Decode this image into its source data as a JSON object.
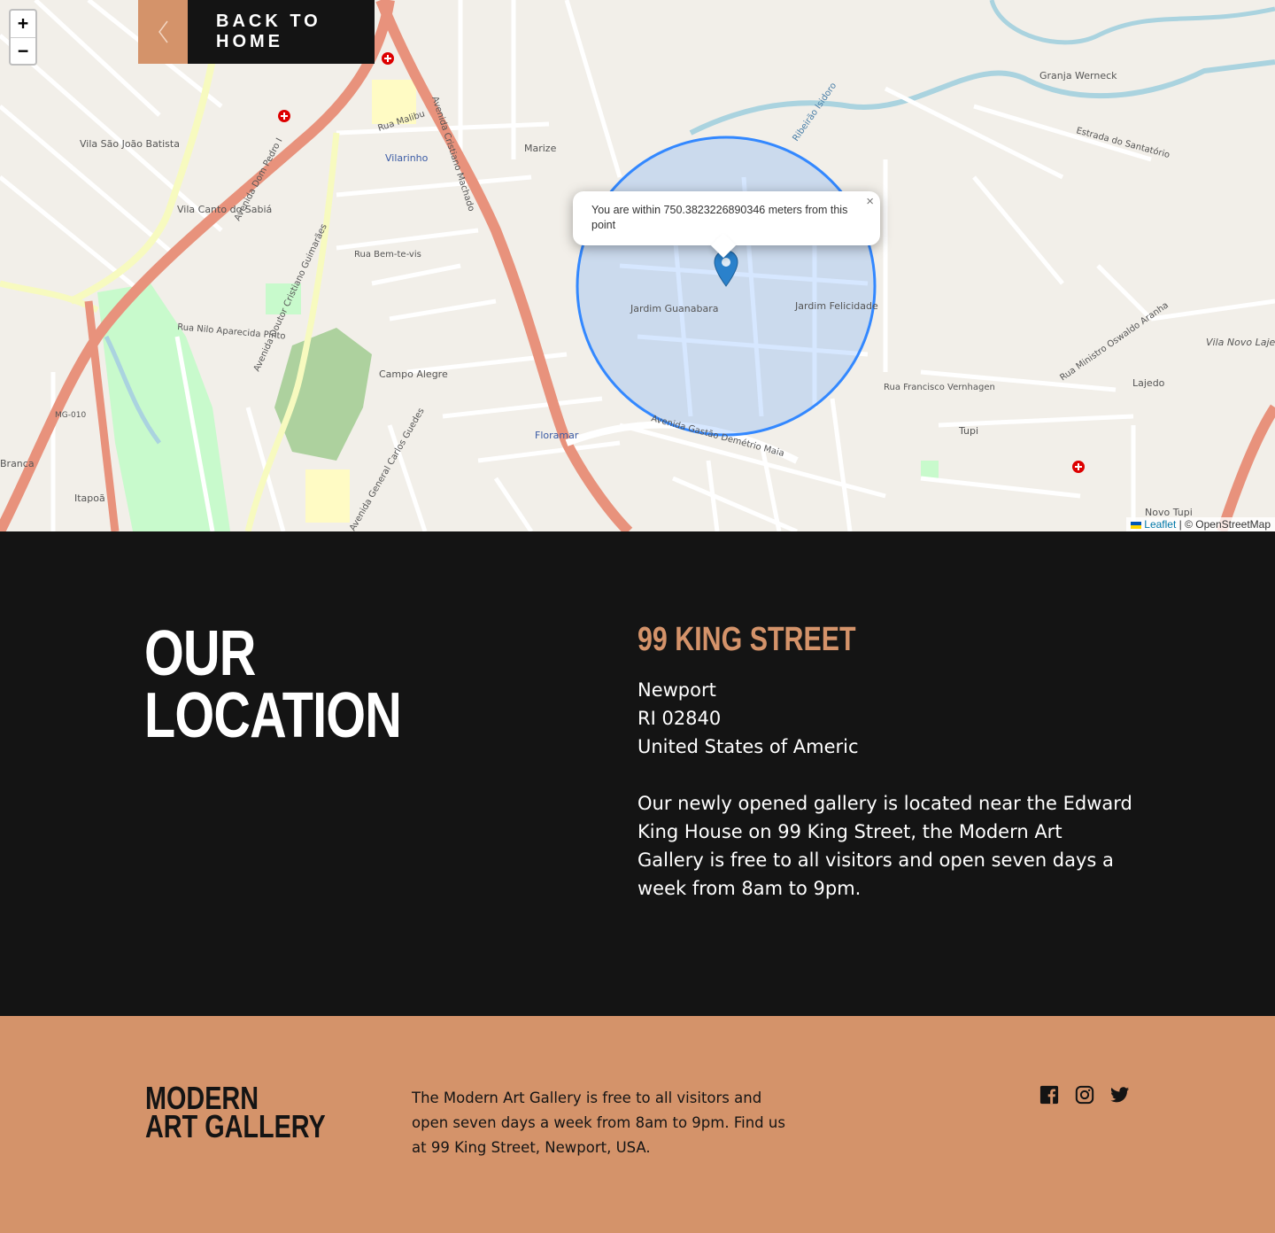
{
  "map": {
    "zoom_in": "+",
    "zoom_out": "−",
    "back_home_label": "BACK TO HOME",
    "popup_text": "You are within 750.3823226890346 meters from this point",
    "popup_close": "×",
    "attribution_leaflet": "Leaflet",
    "attribution_rest": "| © OpenStreetMap",
    "place_labels": [
      "Vila São João Batista",
      "Vilarinho",
      "Vila Canto do Sabiá",
      "Campo Alegre",
      "Floramar",
      "Jardim Guanabara",
      "Jardim Felicidade",
      "Marize",
      "Granja Werneck",
      "Tupi",
      "Lajedo",
      "Vila Novo Lajedo",
      "Itapoã",
      "Branca",
      "Novo Tupi",
      "MG-010"
    ],
    "street_labels": [
      "Avenida Dom Pedro I",
      "Avenida Cristiano Machado",
      "Avenida Doutor Cristiano Guimarães",
      "Avenida Gastão Demétrio Maia",
      "Rua Bem-te-vis",
      "Rua Nilo Aparecida Pinto",
      "Estrada do Santatório",
      "Ribeirão Isidoro",
      "Rua Malibu",
      "Rua Francisco Vernhagen",
      "Avenida General Carlos Guedes",
      "Rua Ministro Oswaldo Aranha"
    ]
  },
  "location": {
    "title_line1": "OUR",
    "title_line2": "LOCATION",
    "street": "99 KING STREET",
    "city": "Newport",
    "zip": "RI 02840",
    "country": "United States of Americ",
    "description": "Our newly opened gallery is located near the Edward King House on 99 King Street, the Modern Art Gallery is free to all visitors and open seven days a week from 8am to 9pm."
  },
  "footer": {
    "logo_line1": "MODERN",
    "logo_line2": "ART GALLERY",
    "text": "The Modern Art Gallery is free to all visitors and open seven days a week from 8am to 9pm. Find us at 99 King Street, Newport, USA.",
    "social_icons": [
      "facebook-icon",
      "instagram-icon",
      "twitter-icon"
    ]
  },
  "colors": {
    "accent": "#d4936a",
    "dark": "#141414",
    "circle": "#3388ff",
    "major_road": "#e8927c"
  }
}
